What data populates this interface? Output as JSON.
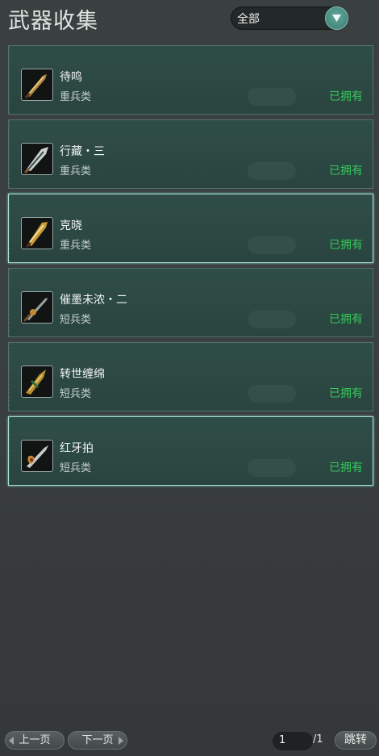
{
  "header": {
    "title": "武器收集"
  },
  "filter": {
    "selected": "全部"
  },
  "weapons": [
    {
      "name": "待鸣",
      "type": "重兵类",
      "status": "已拥有",
      "icon": "heavy-blade-icon"
    },
    {
      "name": "行藏・三",
      "type": "重兵类",
      "status": "已拥有",
      "icon": "heavy-blade-icon"
    },
    {
      "name": "克晓",
      "type": "重兵类",
      "status": "已拥有",
      "icon": "heavy-blade-icon"
    },
    {
      "name": "催墨未浓・二",
      "type": "短兵类",
      "status": "已拥有",
      "icon": "short-blade-icon"
    },
    {
      "name": "转世缠绵",
      "type": "短兵类",
      "status": "已拥有",
      "icon": "short-blade-icon"
    },
    {
      "name": "红牙拍",
      "type": "短兵类",
      "status": "已拥有",
      "icon": "short-blade-icon"
    }
  ],
  "pagination": {
    "prev_label": "上一页",
    "next_label": "下一页",
    "current_page": "1",
    "total_label": "/1",
    "jump_label": "跳转"
  },
  "colors": {
    "owned": "#35c85b",
    "accent": "#5fa79a",
    "card_bg": "#2f4d47"
  }
}
